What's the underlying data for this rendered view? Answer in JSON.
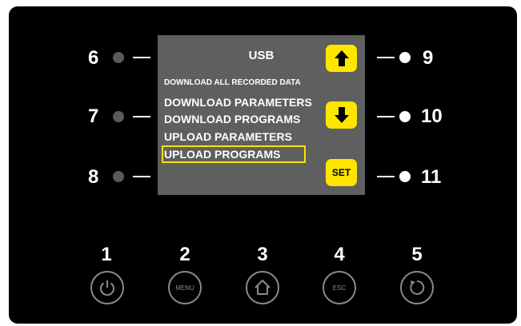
{
  "screen": {
    "title": "USB",
    "items": [
      "DOWNLOAD ALL RECORDED DATA",
      "DOWNLOAD PARAMETERS",
      "DOWNLOAD PROGRAMS",
      "UPLOAD PARAMETERS",
      "UPLOAD PROGRAMS"
    ],
    "selected_index": 4
  },
  "left_indicators": [
    {
      "number": "6",
      "state": "off"
    },
    {
      "number": "7",
      "state": "off"
    },
    {
      "number": "8",
      "state": "off"
    }
  ],
  "right_keys": [
    {
      "number": "9",
      "icon": "arrow-up-icon",
      "state": "on"
    },
    {
      "number": "10",
      "icon": "arrow-down-icon",
      "state": "on"
    },
    {
      "number": "11",
      "label": "SET",
      "state": "on"
    }
  ],
  "bottom_buttons": [
    {
      "number": "1",
      "icon": "power-icon"
    },
    {
      "number": "2",
      "label": "MENU"
    },
    {
      "number": "3",
      "icon": "home-icon"
    },
    {
      "number": "4",
      "label": "ESC"
    },
    {
      "number": "5",
      "icon": "refresh-icon"
    }
  ],
  "colors": {
    "panel": "#000000",
    "screen": "#5f5f5f",
    "accent": "#ffe600",
    "led_off": "#5a5a5a",
    "led_on": "#ffffff",
    "button_ring": "#8a8a8a"
  }
}
